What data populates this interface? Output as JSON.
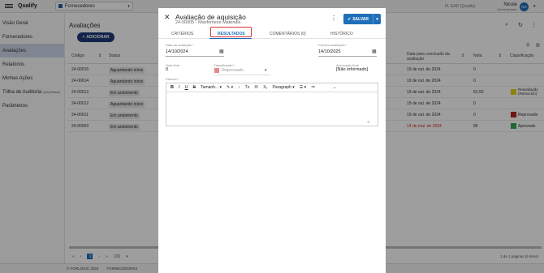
{
  "topbar": {
    "logo": "Qualify",
    "module": "Fornecedores",
    "company": "FL EAD (Qualify)",
    "user_name": "Nicole",
    "user_role": "Administrador",
    "avatar": "NG"
  },
  "sidebar": {
    "items": [
      {
        "label": "Visão Geral",
        "extra": ""
      },
      {
        "label": "Fornecedores",
        "extra": ""
      },
      {
        "label": "Avaliações",
        "extra": ""
      },
      {
        "label": "Relatórios",
        "extra": ""
      },
      {
        "label": "Minhas Ações",
        "extra": ""
      },
      {
        "label": "Trilha de Auditoria",
        "extra": "(Simplificada)"
      },
      {
        "label": "Parâmetros",
        "extra": ""
      }
    ]
  },
  "main": {
    "title": "Avaliações",
    "add_label": "ADICIONAR",
    "columns": {
      "codigo": "Código",
      "status": "Status",
      "data_conclusao": "Data para conclusão da avaliação",
      "nota": "Nota",
      "classificacao": "Classificação"
    },
    "rows": [
      {
        "code": "24-00015",
        "status": "Aguardando início",
        "date": "19 de out. de 2024",
        "nota": "0",
        "class": "",
        "class_color": "",
        "late": false
      },
      {
        "code": "24-00014",
        "status": "Aguardando início",
        "date": "19 de out. de 2024",
        "nota": "0",
        "class": "",
        "class_color": "",
        "late": false
      },
      {
        "code": "24-00013",
        "status": "Em andamento",
        "date": "19 de out. de 2024",
        "nota": "62,50",
        "class": "Reavaliação (Remoción)",
        "class_color": "#e6d21a",
        "late": false
      },
      {
        "code": "24-00012",
        "status": "Aguardando início",
        "date": "19 de out. de 2024",
        "nota": "0",
        "class": "",
        "class_color": "",
        "late": false
      },
      {
        "code": "24-00011",
        "status": "Em andamento",
        "date": "19 de out. de 2024",
        "nota": "0",
        "class": "Reprovado",
        "class_color": "#b3261e",
        "late": false
      },
      {
        "code": "24-00003",
        "status": "Em andamento",
        "date": "14 de mai. de 2024",
        "nota": "85",
        "class": "Aprovado",
        "class_color": "#34a853",
        "late": true
      }
    ],
    "pager": {
      "current": "1",
      "per_page": "100",
      "info": "1 de 1 páginas (6 itens)"
    }
  },
  "footer": {
    "left": "© FORLOGIC 2024",
    "right": "FORNECEDORES"
  },
  "modal": {
    "title": "Avaliação de aquisição",
    "subtitle": "24-00005 - Maxfomece Materials",
    "save_label": "SALVAR",
    "tabs": [
      "CRITÉRIOS",
      "RESULTADOS",
      "COMENTÁRIOS (0)",
      "HISTÓRICO"
    ],
    "fields": {
      "data_label": "Data da avaliação *",
      "data_value": "14/10/2024",
      "proxima_label": "Próxima avaliação *",
      "proxima_value": "14/10/2025",
      "nota_label": "Nota final",
      "nota_value": "0",
      "class_label": "Classificação *",
      "class_value": "Reprovado",
      "aprov_label": "Aprovação final",
      "aprov_value": "[Não informado]",
      "parecer_label": "Parecer *"
    },
    "editor": {
      "font_size": "Tamanh...",
      "paragraph": "Paragraph",
      "char_count": "0"
    }
  }
}
